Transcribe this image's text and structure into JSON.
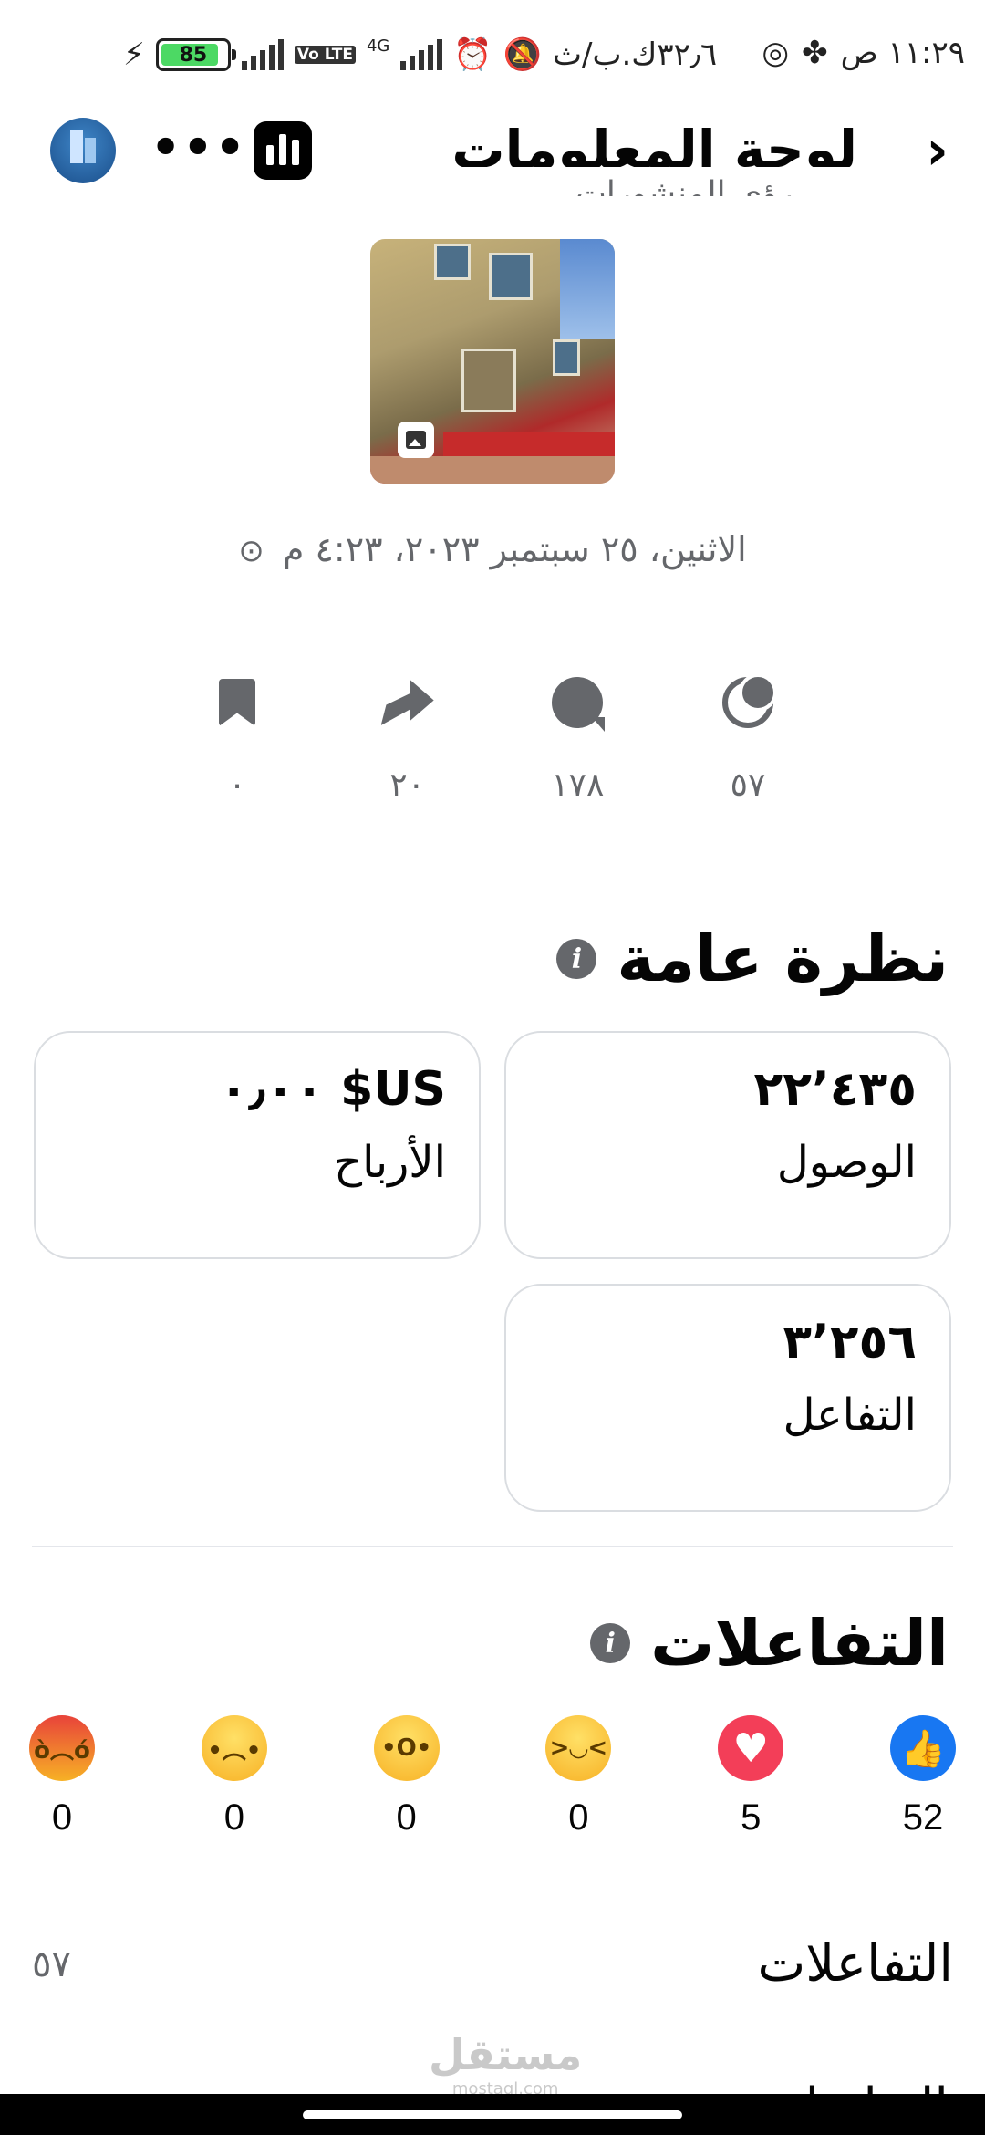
{
  "status_bar": {
    "time": "١١:٢٩ ص",
    "net_speed": "٣٢٫٦ك.ب/ث",
    "battery_level": "85",
    "network_type": "4G",
    "volte": "Vo LTE"
  },
  "header": {
    "title": "لوحة المعلومات",
    "subtitle": "رؤى المنشورات",
    "more_label": "•••"
  },
  "post": {
    "date": "الاثنين، ٢٥ سبتمبر ٢٠٢٣، ٤:٢٣ م"
  },
  "actions": [
    {
      "icon": "reactions-icon",
      "count": "٥٧"
    },
    {
      "icon": "comment-icon",
      "count": "١٧٨"
    },
    {
      "icon": "share-icon",
      "count": "٢٠"
    },
    {
      "icon": "bookmark-icon",
      "count": "٠"
    }
  ],
  "overview": {
    "title": "نظرة عامة",
    "reach": {
      "value": "٢٢٬٤٣٥",
      "label": "الوصول"
    },
    "earnings": {
      "value": "US$ ٠٫٠٠",
      "label": "الأرباح"
    },
    "engagement": {
      "value": "٣٬٢٥٦",
      "label": "التفاعل"
    }
  },
  "reactions": {
    "title": "التفاعلات",
    "items": [
      {
        "icon": "like-icon",
        "count": "52"
      },
      {
        "icon": "love-icon",
        "count": "5"
      },
      {
        "icon": "haha-icon",
        "count": "0"
      },
      {
        "icon": "wow-icon",
        "count": "0"
      },
      {
        "icon": "sad-icon",
        "count": "0"
      },
      {
        "icon": "angry-icon",
        "count": "0"
      }
    ],
    "summary_label": "التفاعلات",
    "summary_value": "٥٧",
    "next_label": "التعليقات"
  },
  "watermark": {
    "line1": "مستقل",
    "line2": "mostaql.com"
  },
  "colors": {
    "accent": "#1877f2",
    "secondary_text": "#65676b",
    "love": "#f33e58"
  }
}
